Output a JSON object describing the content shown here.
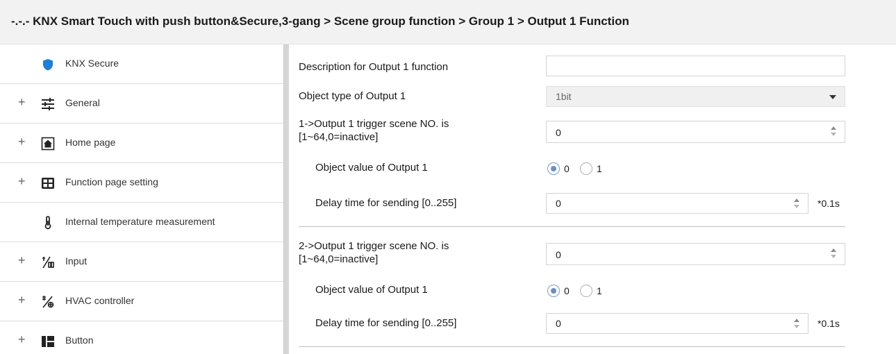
{
  "title": "-.-.- KNX Smart Touch with push button&Secure,3-gang > Scene group function > Group 1 > Output 1 Function",
  "sidebar": {
    "items": [
      {
        "label": "KNX Secure",
        "icon": "shield-icon",
        "expand": ""
      },
      {
        "label": "General",
        "icon": "sliders-icon",
        "expand": "+"
      },
      {
        "label": "Home page",
        "icon": "home-icon",
        "expand": "+"
      },
      {
        "label": "Function page setting",
        "icon": "grid-icon",
        "expand": "+"
      },
      {
        "label": "Internal temperature measurement",
        "icon": "thermometer-icon",
        "expand": ""
      },
      {
        "label": "Input",
        "icon": "input-icon",
        "expand": "+"
      },
      {
        "label": "HVAC controller",
        "icon": "hvac-icon",
        "expand": "+"
      },
      {
        "label": "Button",
        "icon": "button-icon",
        "expand": "+"
      }
    ]
  },
  "form": {
    "description": {
      "label": "Description for Output 1 function",
      "value": ""
    },
    "object_type": {
      "label": "Object type of Output 1",
      "value": "1bit"
    },
    "blocks": [
      {
        "trigger_label_line1": "1->Output 1 trigger scene NO. is",
        "trigger_label_line2": "[1~64,0=inactive]",
        "trigger_value": "0",
        "object_value_label": "Object value of Output 1",
        "radio_options": [
          "0",
          "1"
        ],
        "radio_selected": "0",
        "delay_label": "Delay time for sending [0..255]",
        "delay_value": "0",
        "delay_unit": "*0.1s"
      },
      {
        "trigger_label_line1": "2->Output 1 trigger scene NO. is",
        "trigger_label_line2": "[1~64,0=inactive]",
        "trigger_value": "0",
        "object_value_label": "Object value of Output 1",
        "radio_options": [
          "0",
          "1"
        ],
        "radio_selected": "0",
        "delay_label": "Delay time for sending [0..255]",
        "delay_value": "0",
        "delay_unit": "*0.1s"
      }
    ]
  },
  "colors": {
    "shield": "#1e7fd6",
    "radio_checked": "#6d8fbf",
    "title_bg": "#f2f2f2",
    "splitter": "#d6d6d6"
  }
}
